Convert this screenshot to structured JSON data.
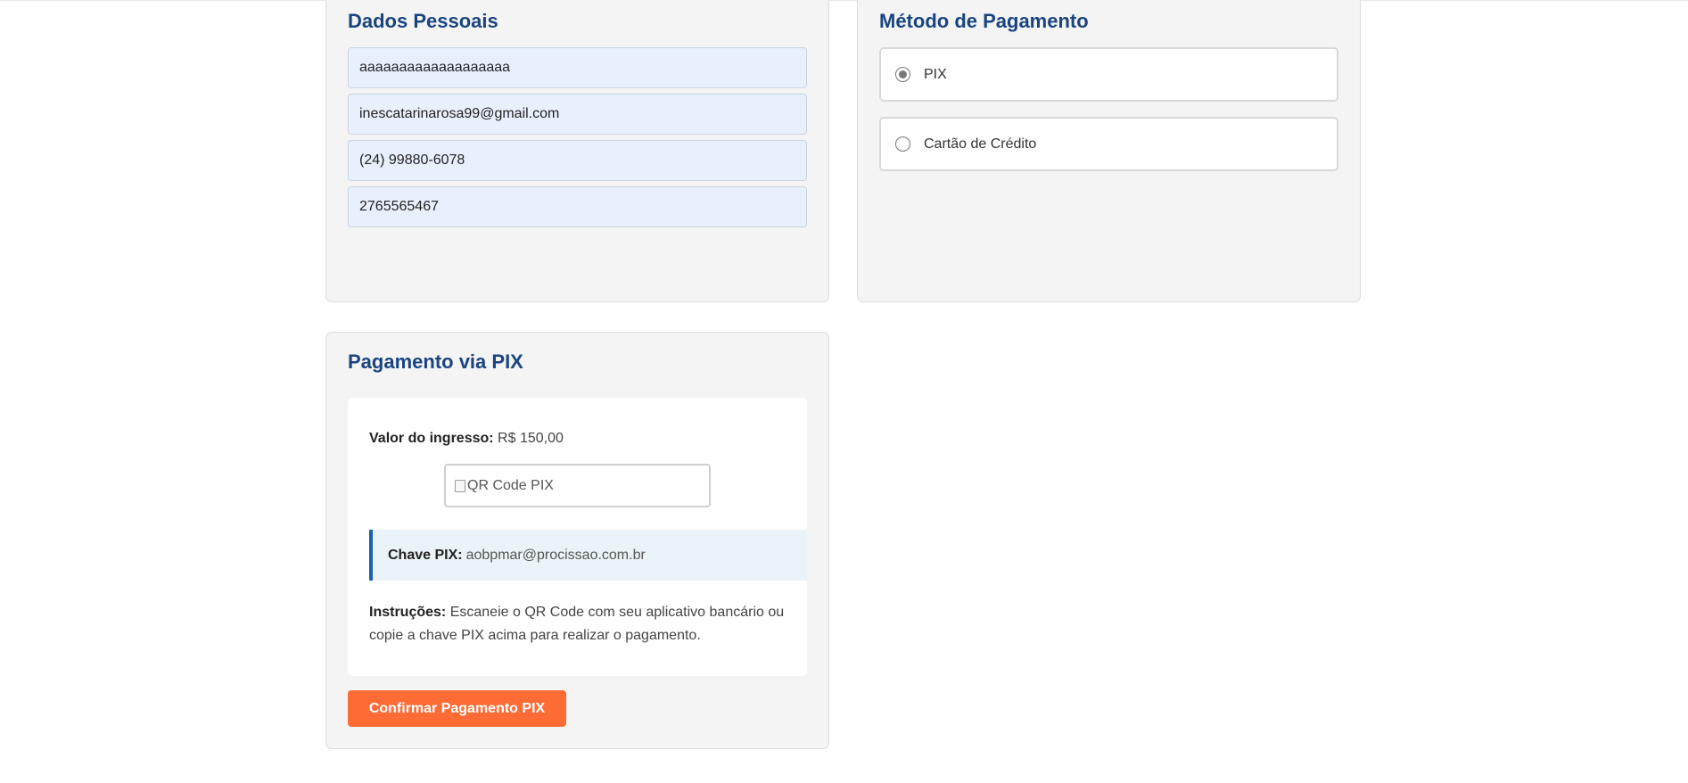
{
  "personal": {
    "title": "Dados Pessoais",
    "fields": {
      "name": "aaaaaaaaaaaaaaaaaaa",
      "email": "inescatarinarosa99@gmail.com",
      "phone": "(24) 99880-6078",
      "document": "2765565467"
    }
  },
  "payment_method": {
    "title": "Método de Pagamento",
    "options": [
      {
        "label": "PIX",
        "selected": true
      },
      {
        "label": "Cartão de Crédito",
        "selected": false
      }
    ]
  },
  "pix": {
    "title": "Pagamento via PIX",
    "value_label": "Valor do ingresso:",
    "value": "R$ 150,00",
    "qr_alt": "QR Code PIX",
    "key_label": "Chave PIX:",
    "key": "aobpmar@procissao.com.br",
    "instructions_label": "Instruções:",
    "instructions": "Escaneie o QR Code com seu aplicativo bancário ou copie a chave PIX acima para realizar o pagamento.",
    "confirm_label": "Confirmar Pagamento PIX"
  },
  "colors": {
    "heading": "#1a4480",
    "accent": "#ff6b35",
    "pix_key_border": "#1a5fb4"
  }
}
